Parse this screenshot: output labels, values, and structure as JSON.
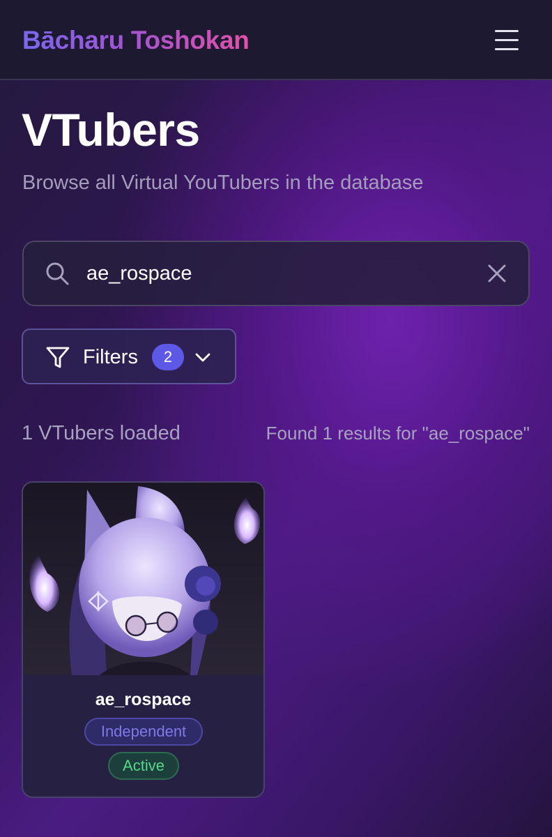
{
  "header": {
    "brand": "Bācharu Toshokan",
    "menu_icon": "hamburger-menu-icon"
  },
  "page": {
    "title": "VTubers",
    "subtitle": "Browse all Virtual YouTubers in the database"
  },
  "search": {
    "value": "ae_rospace",
    "placeholder": "",
    "icon": "search-icon",
    "clear_icon": "close-icon"
  },
  "filters": {
    "label": "Filters",
    "active_count": "2",
    "icon": "filter-funnel-icon",
    "chevron_icon": "chevron-down-icon"
  },
  "status": {
    "loaded_text": "1 VTubers loaded",
    "results_text": "Found 1 results for \"ae_rospace\""
  },
  "results": [
    {
      "name": "ae_rospace",
      "affiliation": "Independent",
      "status": "Active"
    }
  ],
  "colors": {
    "brand_gradient_start": "#7a68ee",
    "brand_gradient_end": "#e052a6",
    "badge_bg": "#5d58e6",
    "affiliation_text": "#8079e6",
    "active_text": "#56d88c",
    "page_bg_accent": "#4a1c82"
  }
}
